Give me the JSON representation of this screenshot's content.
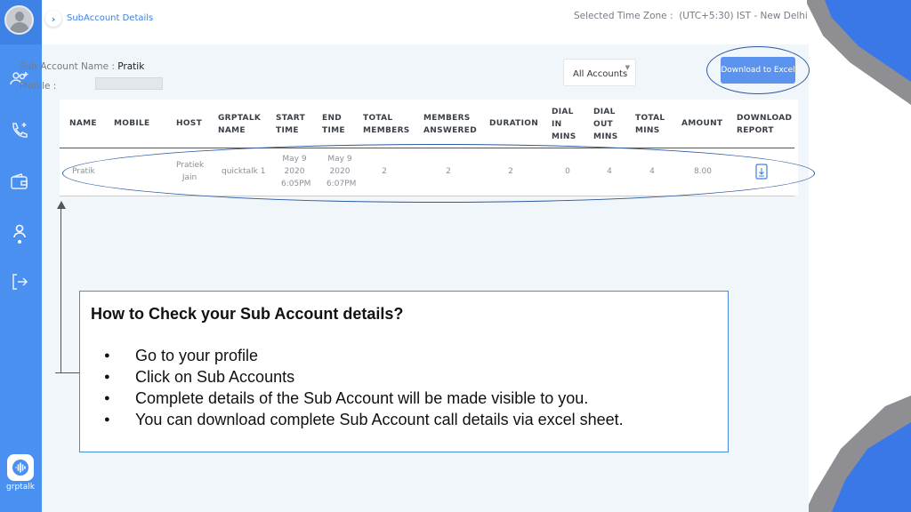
{
  "breadcrumb": {
    "label": "SubAccount Details"
  },
  "timezone": {
    "label": "Selected Time Zone :",
    "value": "(UTC+5:30) IST - New Delhi"
  },
  "sub_account": {
    "name_label": "Sub Account Name :",
    "name_value": "Pratik",
    "mobile_label": "Mobile :"
  },
  "filter": {
    "selected": "All Accounts"
  },
  "download_excel_label": "Download to Excel",
  "table": {
    "headers": [
      "NAME",
      "MOBILE",
      "HOST",
      "GRPTALK\nNAME",
      "START\nTIME",
      "END\nTIME",
      "TOTAL\nMEMBERS",
      "MEMBERS\nANSWERED",
      "DURATION",
      "DIAL\nIN\nMINS",
      "DIAL\nOUT\nMINS",
      "TOTAL\nMINS",
      "AMOUNT",
      "DOWNLOAD\nREPORT"
    ],
    "rows": [
      [
        "Pratik",
        "",
        "Pratiek\nJain",
        "quicktalk 1",
        "May 9\n2020\n6:05PM",
        "May 9\n2020\n6:07PM",
        "2",
        "2",
        "2",
        "0",
        "4",
        "4",
        "8.00"
      ]
    ]
  },
  "help": {
    "title": "How to Check your Sub Account details?",
    "items": [
      "Go to your profile",
      "Click on Sub Accounts",
      "Complete details of the Sub Account will be made visible to you.",
      "You can download complete Sub Account call details via excel sheet."
    ]
  },
  "brand": {
    "name": "grptalk"
  },
  "sidebar": {
    "icons": [
      "add-users-icon",
      "add-call-icon",
      "wallet-icon",
      "profile-icon",
      "logout-icon"
    ]
  },
  "colors": {
    "sidebar": "#4a90f0",
    "accent": "#5b93ef",
    "background": "#f1f6fb",
    "decoration": "#3a78e8"
  }
}
